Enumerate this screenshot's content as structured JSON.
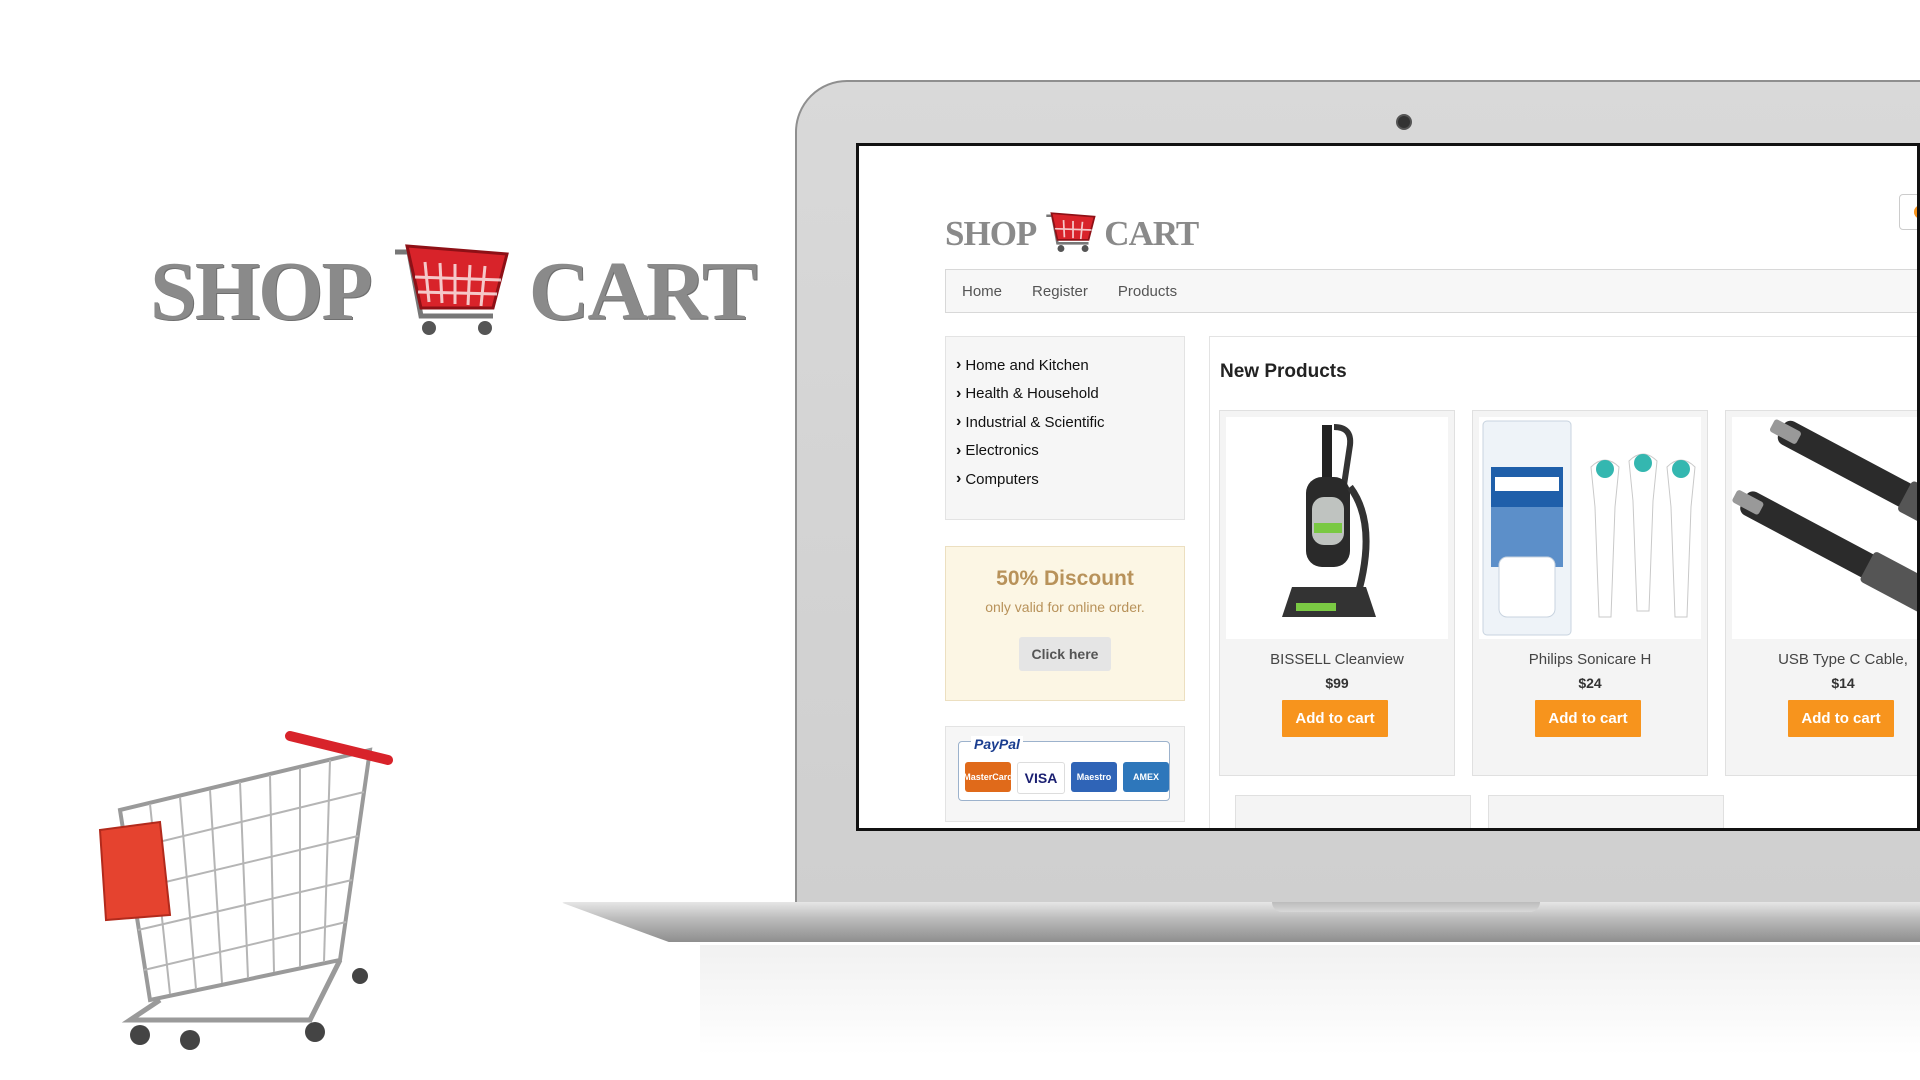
{
  "brand": {
    "word_left": "SHOP",
    "word_right": "CART",
    "accent_color": "#d8232a",
    "text_color": "#8a8a8a"
  },
  "nav": {
    "items": [
      "Home",
      "Register",
      "Products"
    ]
  },
  "categories": [
    "Home and Kitchen",
    "Health & Household",
    "Industrial & Scientific",
    "Electronics",
    "Computers"
  ],
  "promo": {
    "title": "50% Discount",
    "subtitle": "only valid for online order.",
    "button_label": "Click here"
  },
  "payments": {
    "label": "PayPal",
    "cards": [
      "MasterCard",
      "VISA",
      "Maestro",
      "AMEX"
    ]
  },
  "products_section": {
    "heading": "New Products",
    "items": [
      {
        "name": "BISSELL Cleanview",
        "price": "$99",
        "button": "Add to cart",
        "icon": "vacuum-cleaner-icon"
      },
      {
        "name": "Philips Sonicare H",
        "price": "$24",
        "button": "Add to cart",
        "icon": "toothbrush-heads-icon"
      },
      {
        "name": "USB Type C Cable,",
        "price": "$14",
        "button": "Add to cart",
        "icon": "usb-cable-icon"
      }
    ]
  },
  "colors": {
    "accent_orange": "#f7941d",
    "promo_bg": "#fcf6e4",
    "promo_text": "#b8925a"
  }
}
